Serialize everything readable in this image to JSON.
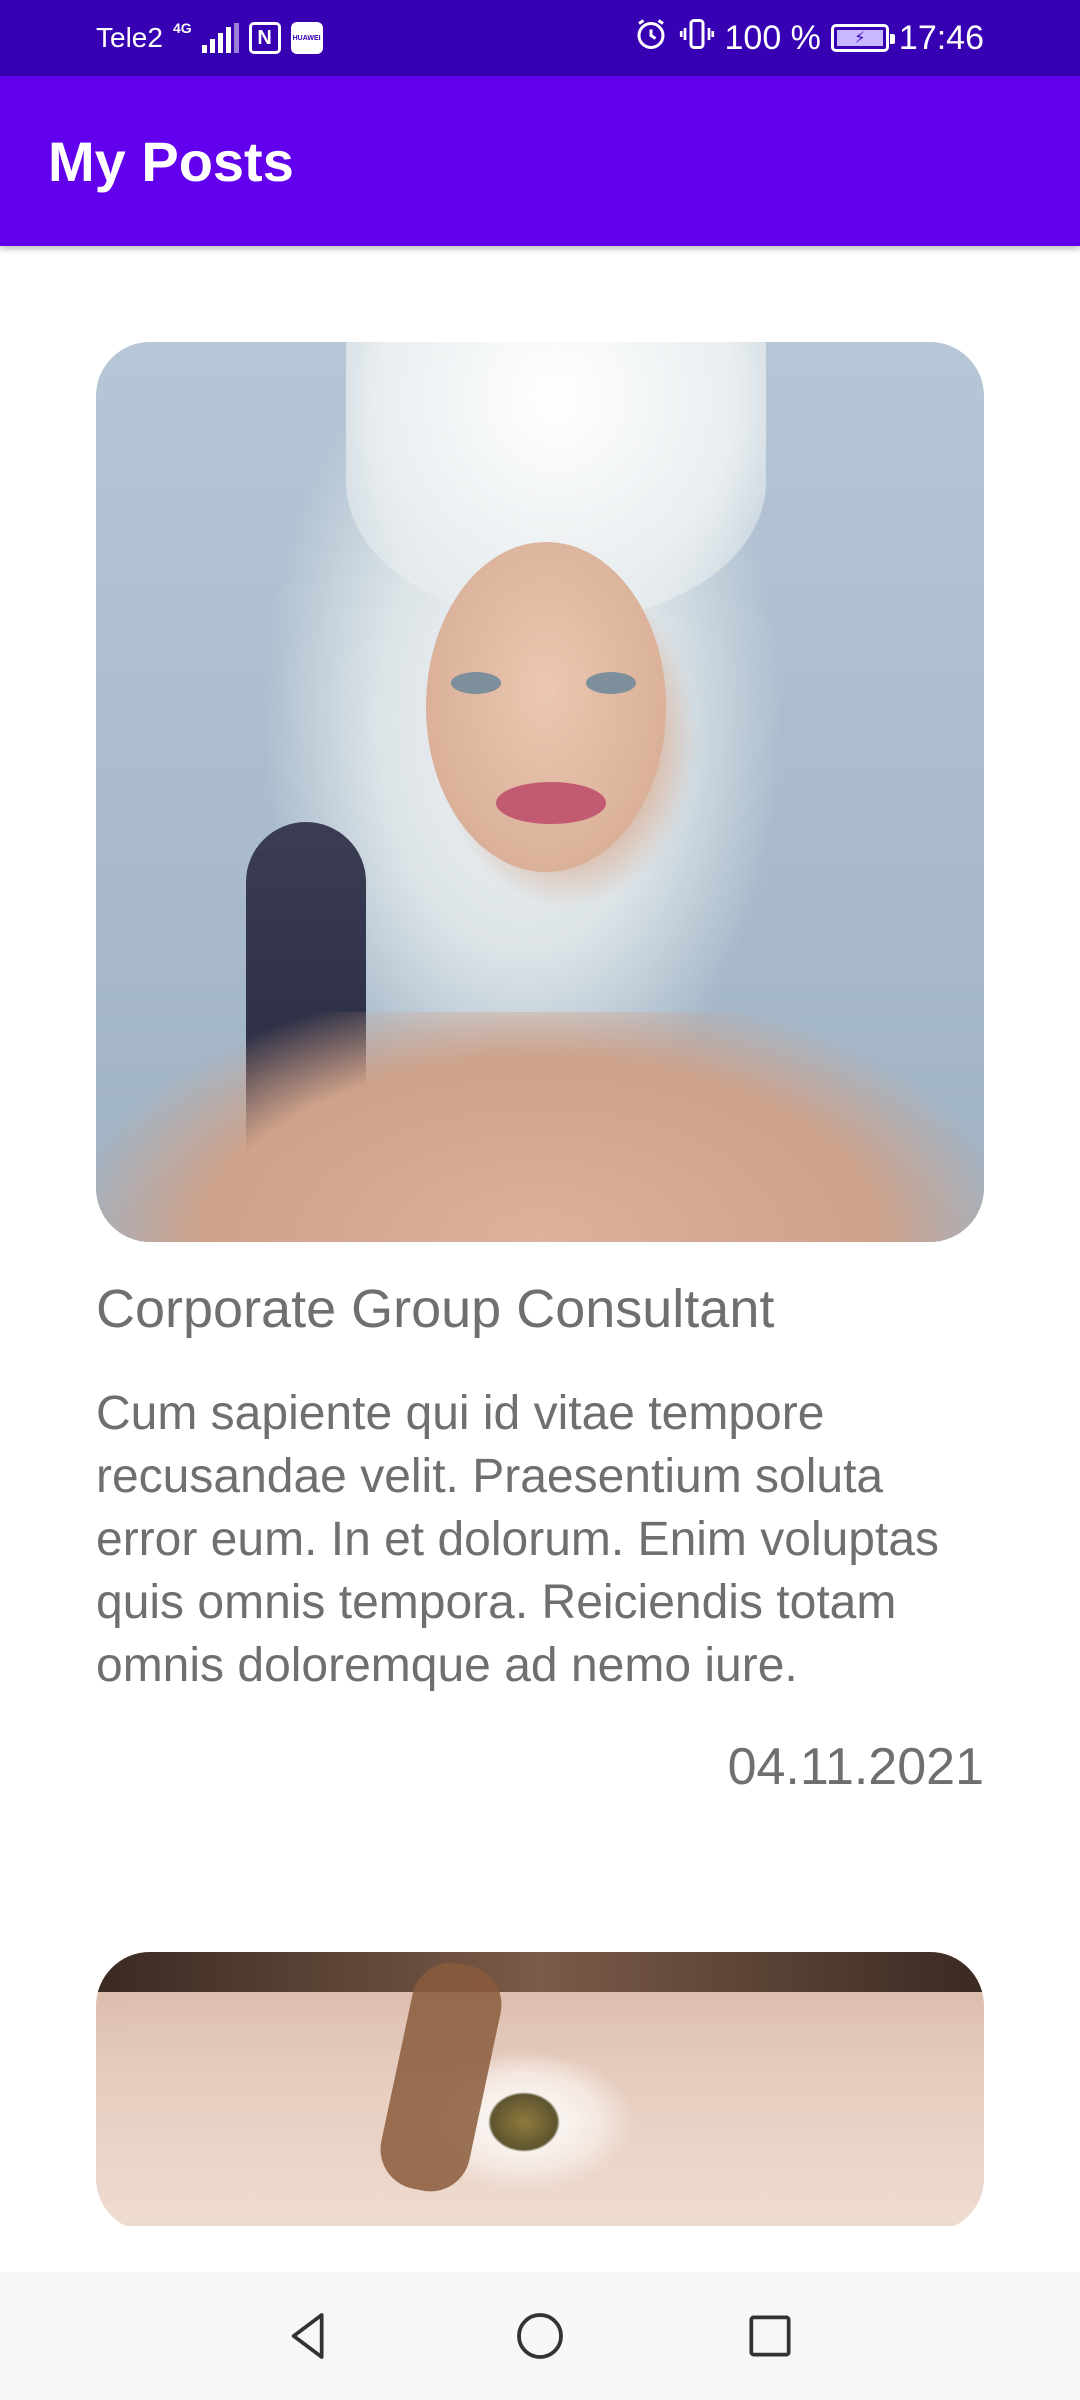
{
  "status_bar": {
    "carrier": "Tele2",
    "network_type": "4G",
    "nfc_label": "N",
    "huawei_label": "HUAWEI",
    "battery_percent": "100 %",
    "time": "17:46"
  },
  "app_bar": {
    "title": "My Posts"
  },
  "posts": [
    {
      "title": "Corporate Group Consultant",
      "body": "Cum sapiente qui id vitae tempore recusandae velit. Praesentium soluta error eum. In et dolorum. Enim voluptas quis omnis tempora. Reiciendis totam omnis doloremque ad nemo iure.",
      "date": "04.11.2021"
    }
  ],
  "colors": {
    "status_bar": "#3700B3",
    "app_bar": "#6200EE",
    "text": "#6f6f6f"
  },
  "icons": {
    "nav_back": "back-triangle-icon",
    "nav_home": "home-circle-icon",
    "nav_recent": "recents-square-icon"
  }
}
